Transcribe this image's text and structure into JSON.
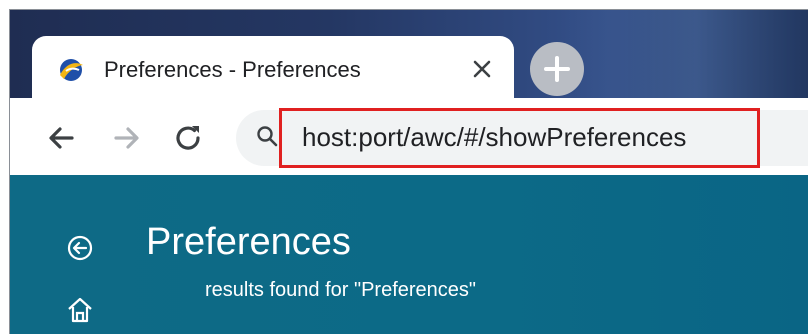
{
  "browser": {
    "tab": {
      "title": "Preferences - Preferences",
      "favicon": "app-logo-icon",
      "close_icon": "close-icon"
    },
    "new_tab_icon": "plus-icon",
    "toolbar": {
      "back_icon": "arrow-left-icon",
      "forward_icon": "arrow-right-icon",
      "reload_icon": "reload-icon",
      "search_icon": "search-icon",
      "url": "host:port/awc/#/showPreferences",
      "highlight_color": "#e02020"
    }
  },
  "app": {
    "background_color": "#0c6a87",
    "back_icon": "circle-back-icon",
    "home_icon": "home-icon",
    "page_title": "Preferences",
    "results_text": "results found for \"Preferences\""
  }
}
